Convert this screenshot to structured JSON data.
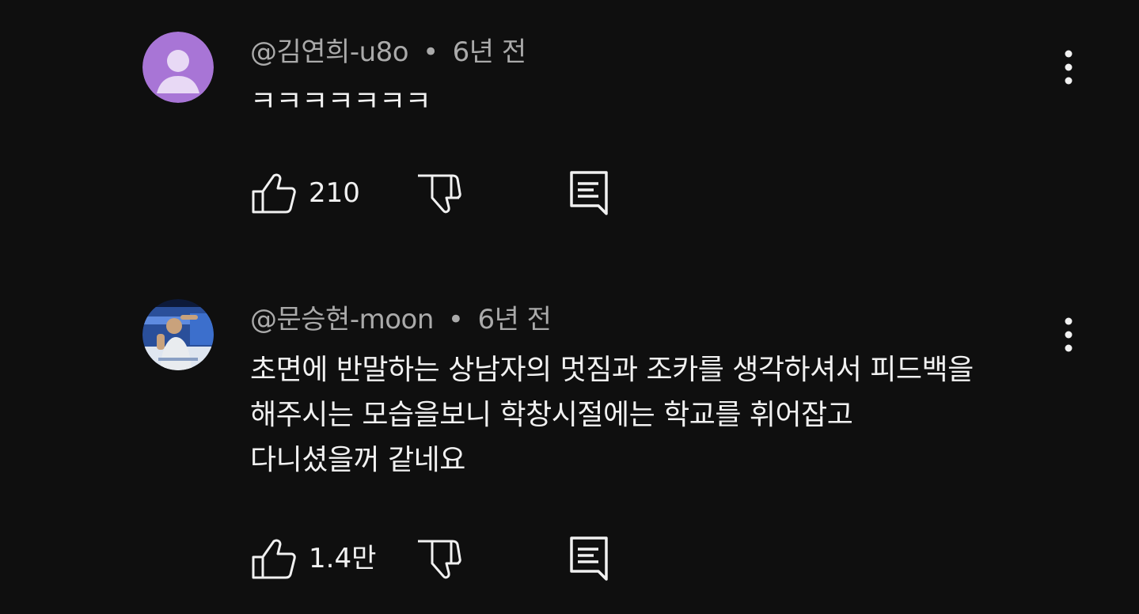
{
  "comments": [
    {
      "author": "@김연희-u8o",
      "separator": "•",
      "time": "6년 전",
      "body_lines": [
        "ㅋㅋㅋㅋㅋㅋㅋ"
      ],
      "like_count": "210",
      "avatar_color": "#a875d6"
    },
    {
      "author": "@문승현-moon",
      "separator": "•",
      "time": "6년 전",
      "body_lines": [
        "초면에 반말하는 상남자의 멋짐과 조카를 생각하셔서 피드백을",
        "해주시는 모습을보니 학창시절에는 학교를 휘어잡고",
        "다니셨을꺼 같네요"
      ],
      "like_count": "1.4만",
      "avatar_color": "#2a4f9a"
    }
  ],
  "colors": {
    "background": "#0f0f0f",
    "text_primary": "#f1f1f1",
    "text_secondary": "#aaaaaa"
  }
}
